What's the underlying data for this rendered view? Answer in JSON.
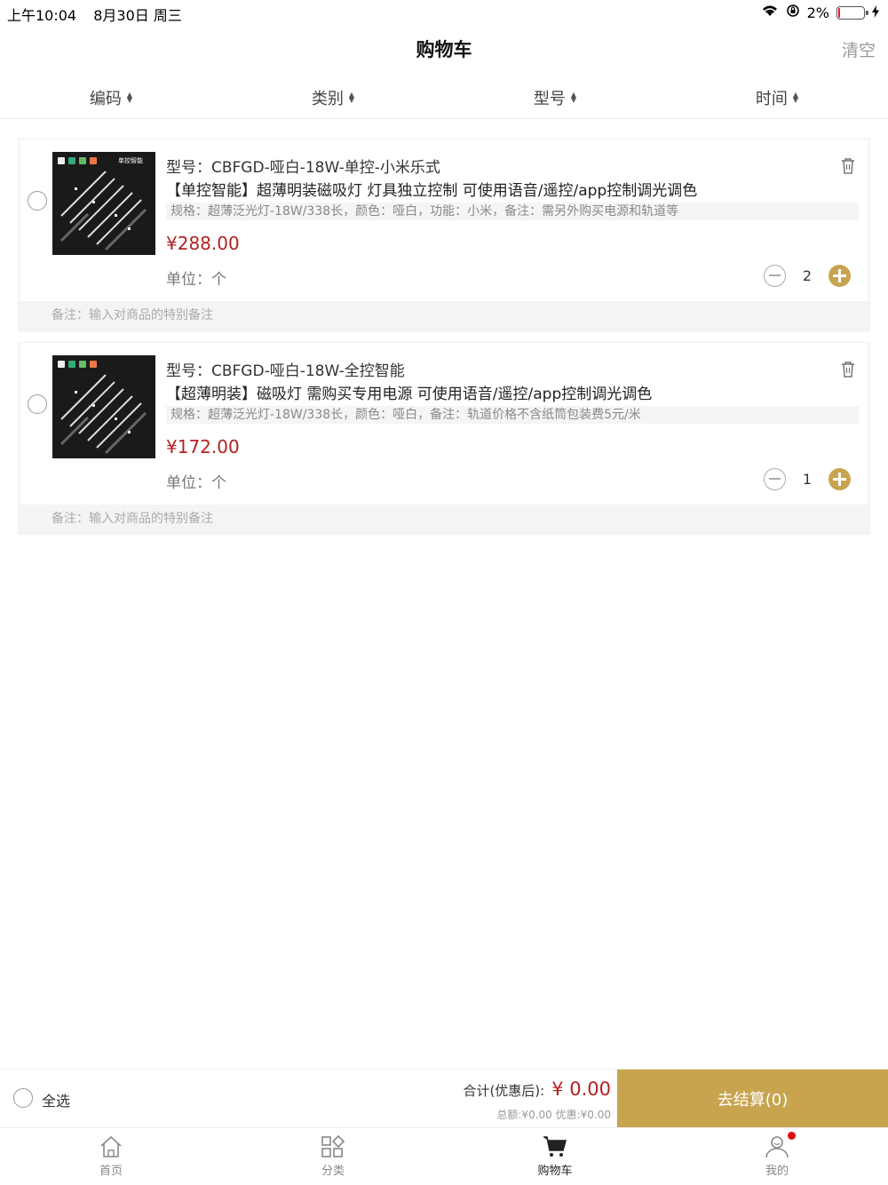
{
  "status_bar": {
    "time": "上午10:04",
    "date": "8月30日 周三",
    "battery": "2%",
    "battery_level": 0.02
  },
  "nav": {
    "title": "购物车",
    "clear_label": "清空"
  },
  "sort": [
    {
      "label": "编码"
    },
    {
      "label": "类别"
    },
    {
      "label": "型号"
    },
    {
      "label": "时间"
    }
  ],
  "cart": {
    "items": [
      {
        "model": "型号：CBFGD-哑白-18W-单控-小米乐式",
        "description": "【单控智能】超薄明装磁吸灯 灯具独立控制 可使用语音/遥控/app控制调光调色",
        "spec": "规格：超薄泛光灯-18W/338长，颜色：哑白，功能：小米，备注：需另外购买电源和轨道等",
        "price": "¥288.00",
        "unit": "单位：个",
        "quantity": "2",
        "remark_placeholder": "备注：输入对商品的特别备注",
        "thumb_label": "单控智能"
      },
      {
        "model": "型号：CBFGD-哑白-18W-全控智能",
        "description": "【超薄明装】磁吸灯 需购买专用电源 可使用语音/遥控/app控制调光调色",
        "spec": "规格：超薄泛光灯-18W/338长，颜色：哑白，备注：轨道价格不含纸筒包装费5元/米",
        "price": "¥172.00",
        "unit": "单位：个",
        "quantity": "1",
        "remark_placeholder": "备注：输入对商品的特别备注",
        "thumb_label": ""
      }
    ]
  },
  "checkout": {
    "select_all_label": "全选",
    "total_label": "合计(优惠后):",
    "total_value": "¥ 0.00",
    "subtotal_line": "总额:¥0.00 优惠:¥0.00",
    "button_label": "去结算(0)"
  },
  "tabs": [
    {
      "label": "首页",
      "icon": "home-icon"
    },
    {
      "label": "分类",
      "icon": "category-icon"
    },
    {
      "label": "购物车",
      "icon": "cart-icon"
    },
    {
      "label": "我的",
      "icon": "profile-icon"
    }
  ],
  "colors": {
    "accent": "#c8a44f",
    "price": "#b22222",
    "badge": "#dd1111"
  }
}
